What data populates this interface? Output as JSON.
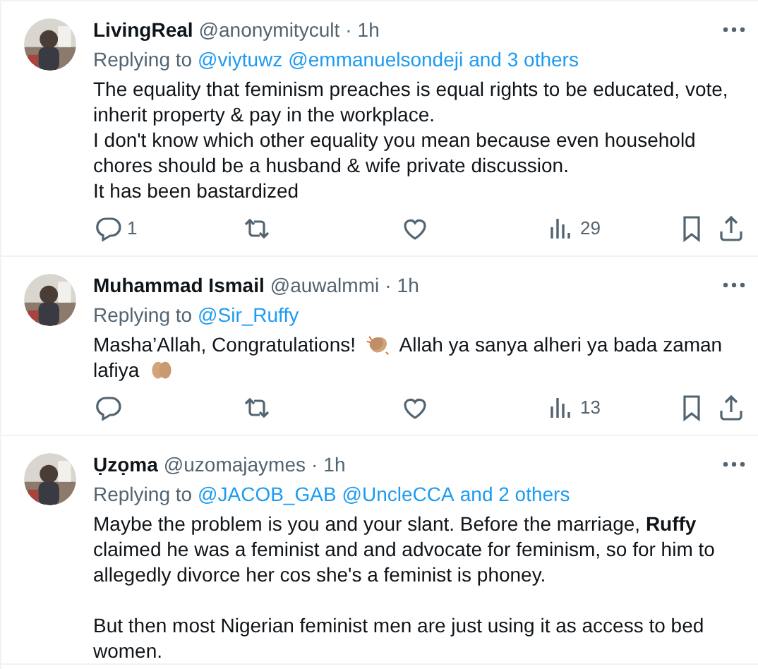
{
  "tweets": [
    {
      "author": "LivingReal",
      "handle": "@anonymitycult",
      "dot": "·",
      "time": "1h",
      "reply_to": {
        "label": "Replying to",
        "mentions": [
          "@viytuwz",
          "@emmanuelsondeji"
        ],
        "others": "and 3 others"
      },
      "body": "The equality that feminism preaches is equal rights to be educated, vote, inherit property & pay in the workplace.\nI don't know which other equality you mean because even household chores should be a husband & wife private discussion.\nIt has been bastardized",
      "actions": {
        "replies": "1",
        "views": "29"
      }
    },
    {
      "author": "Muhammad Ismail",
      "handle": "@auwalmmi",
      "dot": "·",
      "time": "1h",
      "reply_to": {
        "label": "Replying to",
        "mentions": [
          "@Sir_Ruffy"
        ]
      },
      "body": [
        {
          "kind": "text",
          "text": "Masha’Allah, Congratulations!"
        },
        {
          "kind": "clap"
        },
        {
          "kind": "text",
          "text": "Allah ya sanya alheri ya bada zaman"
        },
        {
          "kind": "text",
          "text": "lafiya"
        },
        {
          "kind": "pray"
        }
      ],
      "actions": {
        "views": "13"
      }
    },
    {
      "author": "Ụzọma",
      "handle": "@uzomajaymes",
      "dot": "·",
      "time": "1h",
      "reply_to": {
        "label": "Replying to",
        "mentions": [
          "@JACOB_GAB",
          "@UncleCCA"
        ],
        "others": "and 2 others"
      },
      "body": "Maybe the problem is you and your slant. Before the marriage, **Ruffy** claimed he was a feminist and and advocate for feminism, so for him to allegedly divorce her cos she's a feminist is phoney.\n\nBut then most Nigerian feminist men are just using it as access to bed women."
    }
  ]
}
